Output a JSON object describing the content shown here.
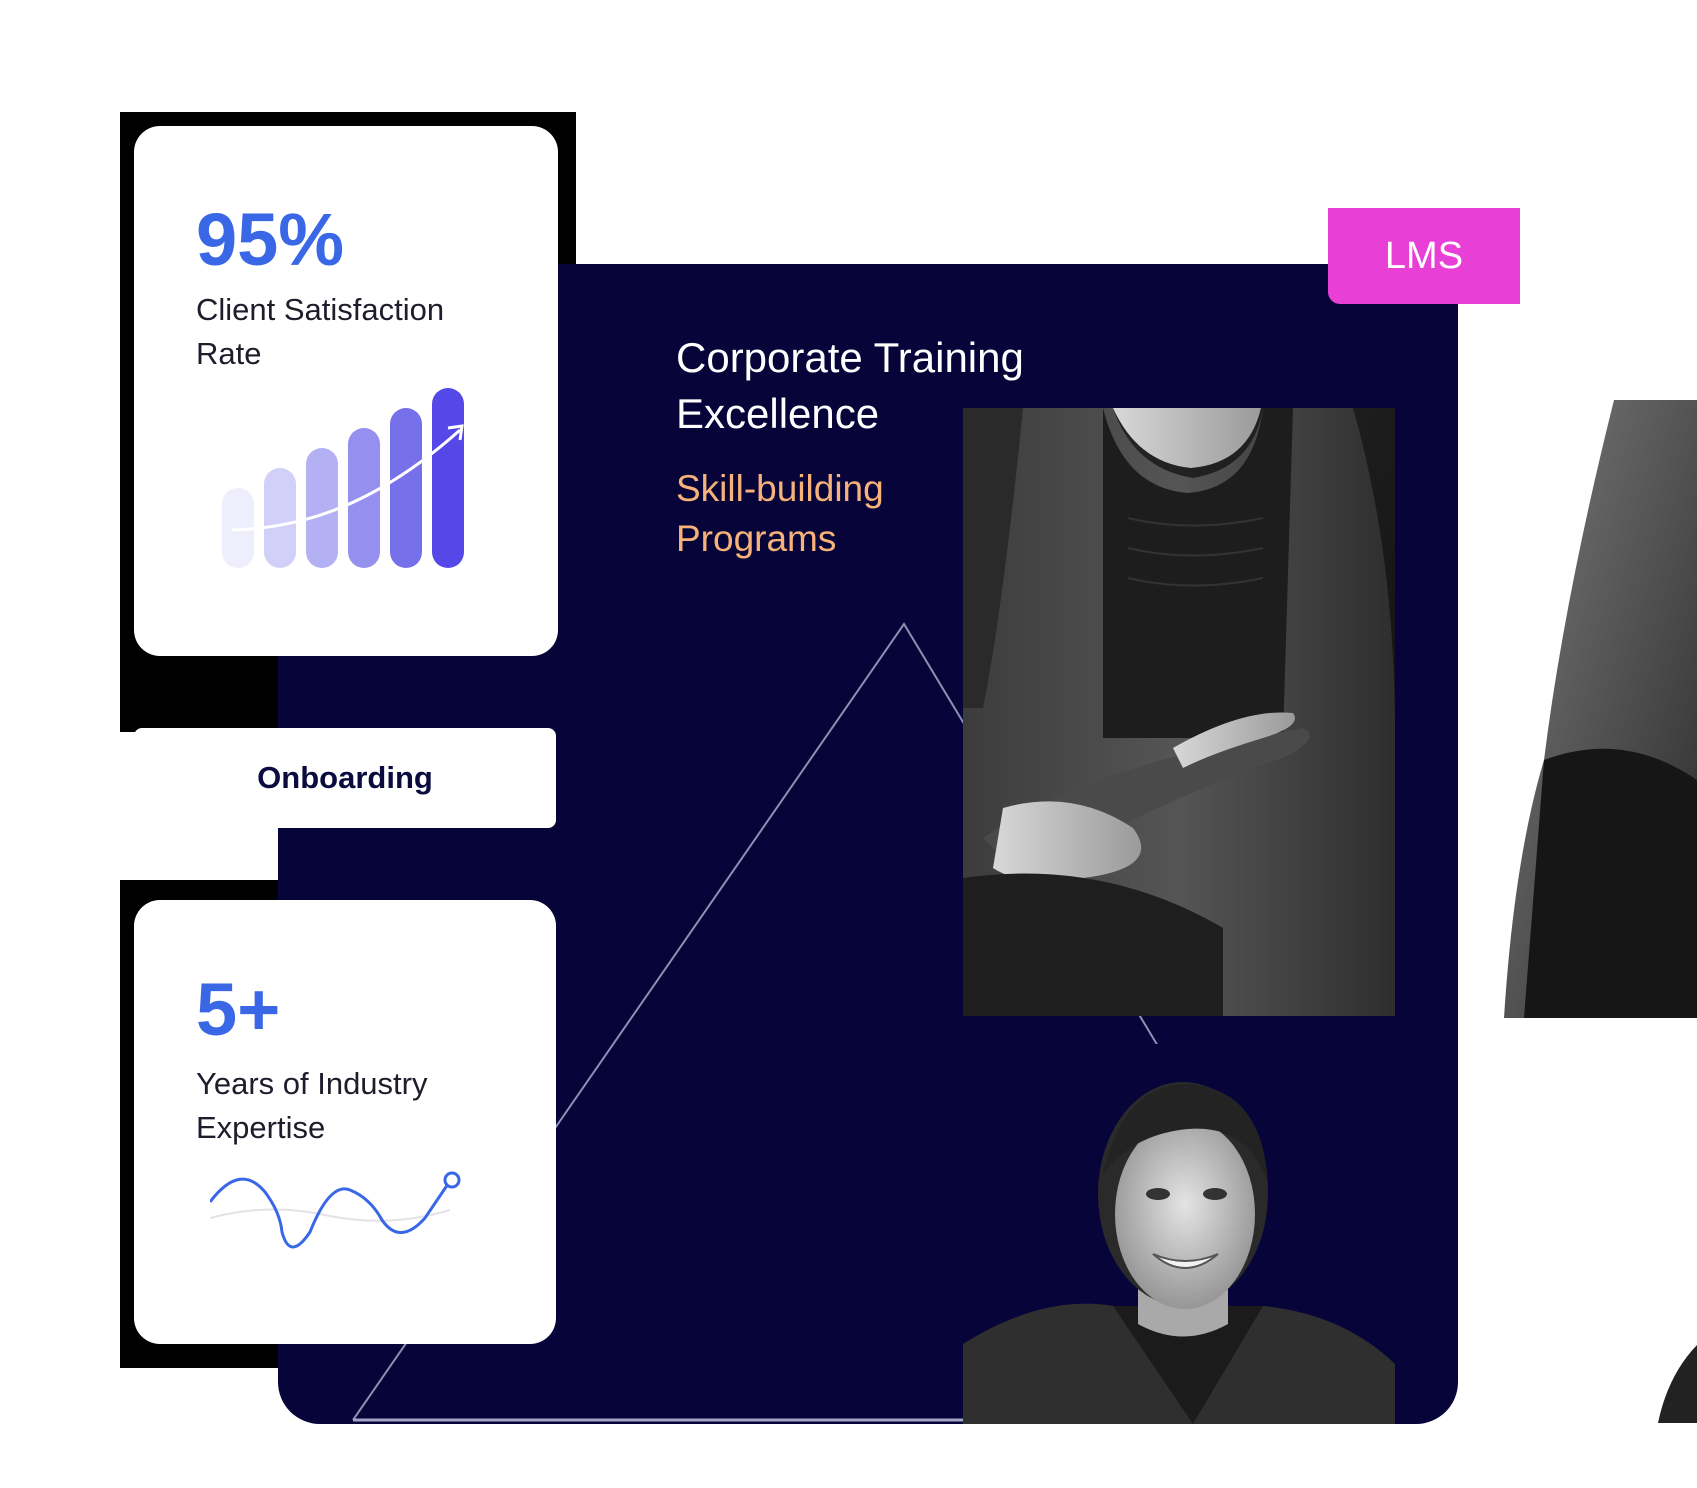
{
  "panel": {
    "heading_line1": "Corporate Training",
    "heading_line2": "Excellence",
    "subheading_line1": "Skill-building",
    "subheading_line2": "Programs",
    "badge": "LMS",
    "background_color": "#07043a",
    "subheading_color": "#f7b27a",
    "badge_color": "#e83fd6"
  },
  "cards": {
    "satisfaction": {
      "value": "95%",
      "label_line1": "Client Satisfaction",
      "label_line2": "Rate",
      "icon": "bar-chart-growth-icon"
    },
    "pill": {
      "label": "Onboarding"
    },
    "expertise": {
      "value": "5+",
      "label_line1": "Years of Industry",
      "label_line2": "Expertise",
      "icon": "wave-line-icon"
    }
  },
  "accent_color": "#3a67e6"
}
